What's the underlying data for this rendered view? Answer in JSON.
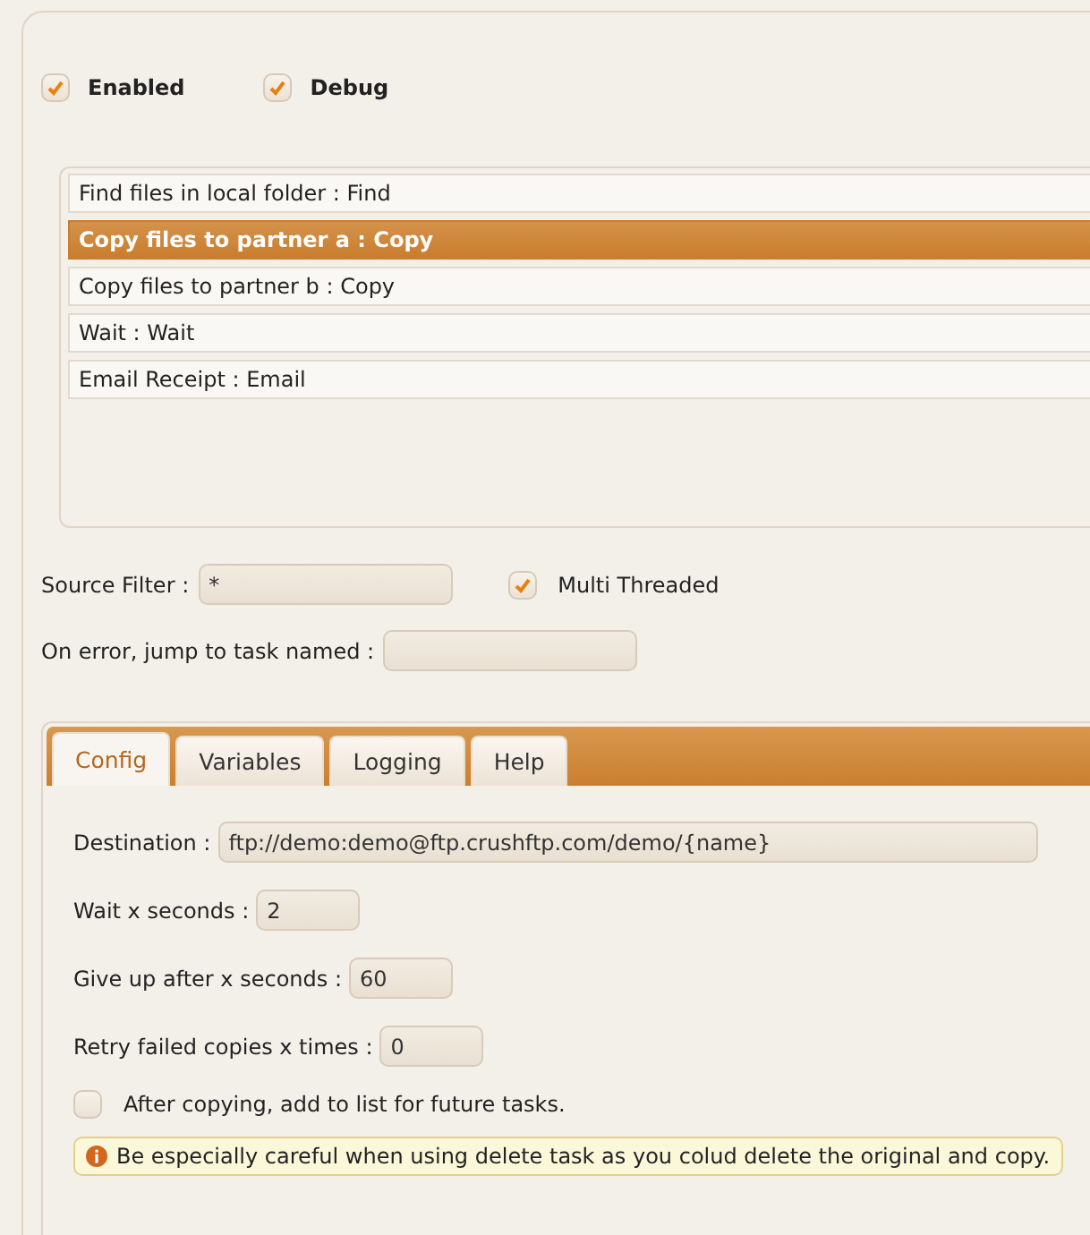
{
  "options": [
    {
      "label": "Enabled",
      "checked": true
    },
    {
      "label": "Debug",
      "checked": true
    }
  ],
  "tasks": [
    {
      "label": "Find files in local folder : Find",
      "selected": false
    },
    {
      "label": "Copy files to partner a : Copy",
      "selected": true
    },
    {
      "label": "Copy files to partner b : Copy",
      "selected": false
    },
    {
      "label": "Wait : Wait",
      "selected": false
    },
    {
      "label": "Email Receipt : Email",
      "selected": false
    }
  ],
  "source_filter": {
    "label": "Source Filter :",
    "value": "*"
  },
  "multi_threaded": {
    "label": "Multi Threaded",
    "checked": true
  },
  "on_error": {
    "label": "On error, jump to task named :"
  },
  "tabs": [
    {
      "label": "Config",
      "selected": true
    },
    {
      "label": "Variables",
      "selected": false
    },
    {
      "label": "Logging",
      "selected": false
    },
    {
      "label": "Help",
      "selected": false
    }
  ],
  "fields": [
    {
      "label": "Destination :",
      "value": "ftp://demo:demo@ftp.crushftp.com/demo/{name}",
      "kind": "wide"
    },
    {
      "label": "Wait x seconds :",
      "value": "2",
      "kind": "short"
    },
    {
      "label": "Give up after x seconds :",
      "value": "60",
      "kind": "short"
    },
    {
      "label": "Retry failed copies x times :",
      "value": "0",
      "kind": "short"
    }
  ],
  "add_to_list": {
    "label": "After copying, add to list for future tasks.",
    "checked": false
  },
  "warning": "Be especially careful when using delete task as you colud delete the original and copy."
}
